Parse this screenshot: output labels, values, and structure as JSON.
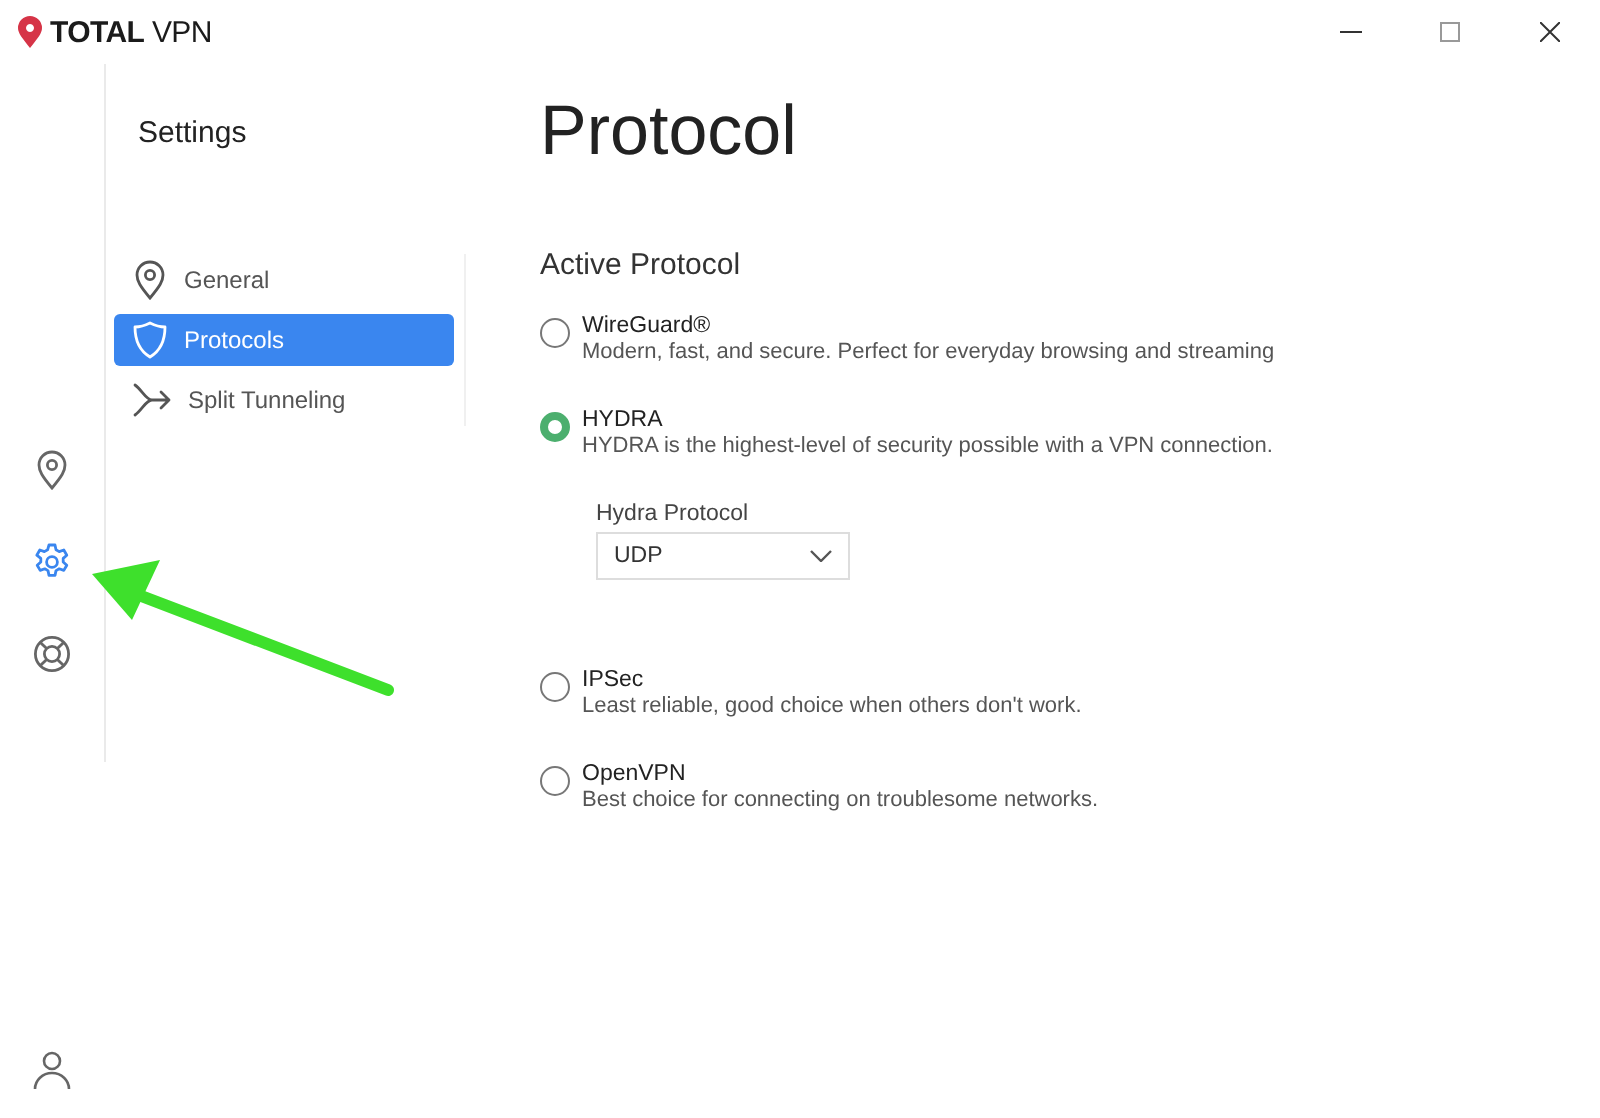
{
  "app": {
    "logo": "**TOTAL** VPN"
  },
  "window_controls": [
    {
      "kind": "minimize"
    },
    {
      "kind": "maximize"
    },
    {
      "kind": "close"
    }
  ],
  "rail": [
    {
      "kind": "location",
      "selected": false
    },
    {
      "kind": "settings",
      "selected": true
    },
    {
      "kind": "support",
      "selected": false
    }
  ],
  "settings_nav": {
    "title": "Settings",
    "items": [
      {
        "kind": "location",
        "label": "General",
        "selected": false
      },
      {
        "kind": "shield",
        "label": "Protocols",
        "selected": true
      },
      {
        "kind": "split",
        "label": "Split Tunneling",
        "selected": false
      }
    ]
  },
  "page": {
    "title": "Protocol",
    "section": "Active Protocol",
    "options": [
      {
        "name": "WireGuard®",
        "description": "Modern, fast, and secure. Perfect for everyday browsing and streaming",
        "selected": false
      },
      {
        "name": "HYDRA",
        "description": "HYDRA is the highest-level of security possible with a VPN connection.",
        "selected": true,
        "sub_setting": {
          "label": "Hydra Protocol",
          "value": "UDP"
        }
      },
      {
        "name": "IPSec",
        "description": "Least reliable, good choice when others don't work.",
        "selected": false
      },
      {
        "name": "OpenVPN",
        "description": "Best choice for connecting on troublesome networks.",
        "selected": false
      }
    ]
  },
  "annotation": {
    "kind": "arrow"
  }
}
